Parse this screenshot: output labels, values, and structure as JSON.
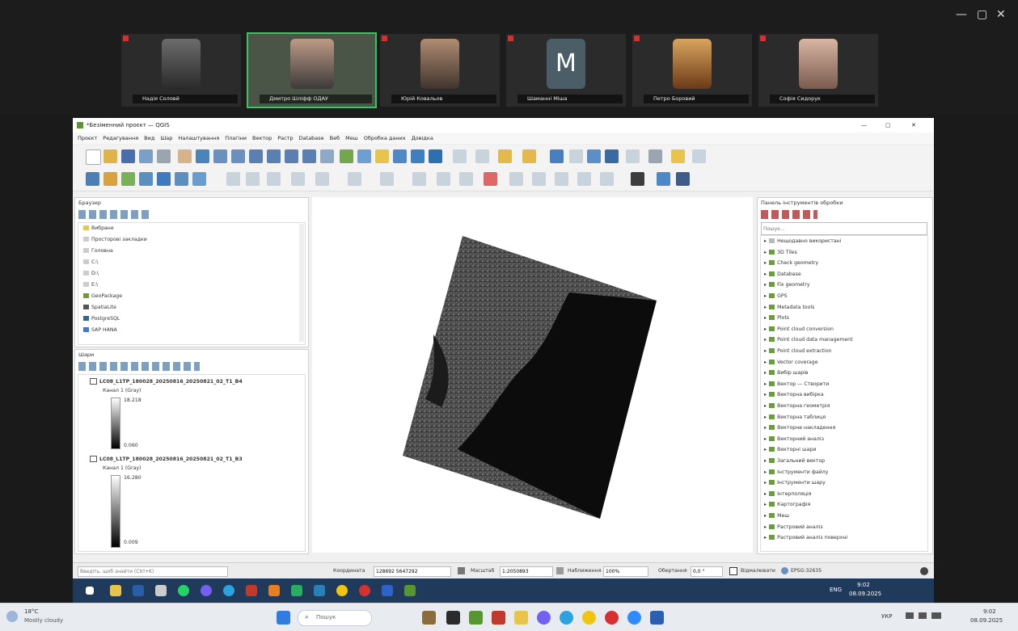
{
  "meeting": {
    "participants": [
      {
        "name": "Надія Соловй",
        "active": false
      },
      {
        "name": "Дмитро Шліфф ОДАУ",
        "active": true
      },
      {
        "name": "Юрій Ковальов",
        "active": false
      },
      {
        "name": "Шаманні Міша",
        "active": false,
        "initial": "M"
      },
      {
        "name": "Петро Боровий",
        "active": false
      },
      {
        "name": "Софія Сидорук",
        "active": false
      }
    ],
    "window_controls": [
      "—",
      "▢",
      "✕"
    ]
  },
  "qgis": {
    "title": "*Безіменний проєкт — QGIS",
    "window_controls": [
      "—",
      "▢",
      "✕"
    ],
    "menu": [
      "Проєкт",
      "Редагування",
      "Вид",
      "Шар",
      "Налаштування",
      "Плагіни",
      "Вектор",
      "Растр",
      "Database",
      "Веб",
      "Меш",
      "Обробка даних",
      "Довідка"
    ],
    "browser": {
      "title": "Браузер",
      "items": [
        "Вибране",
        "Просторові закладки",
        "Головна",
        "C:\\",
        "D:\\",
        "E:\\",
        "GeoPackage",
        "SpatiaLite",
        "PostgreSQL",
        "SAP HANA"
      ]
    },
    "layers": {
      "title": "Шари",
      "items": [
        {
          "name": "LC08_L1TP_180028_20250816_20250821_02_T1_B4",
          "band": "Канал 1 (Gray)",
          "max": "18.218",
          "min": "0.060"
        },
        {
          "name": "LC08_L1TP_180028_20250816_20250821_02_T1_B3",
          "band": "Канал 1 (Gray)",
          "max": "16.280",
          "min": "0.009"
        }
      ]
    },
    "processing": {
      "title": "Панель інструментів обробки",
      "search_placeholder": "Пошук...",
      "items": [
        "Нещодавно використані",
        "3D Tiles",
        "Check geometry",
        "Database",
        "Fix geometry",
        "GPS",
        "Metadata tools",
        "Plots",
        "Point cloud conversion",
        "Point cloud data management",
        "Point cloud extraction",
        "Vector coverage",
        "Вибір шарів",
        "Вектор — Створити",
        "Векторна вибірка",
        "Векторна геометрія",
        "Векторна таблиця",
        "Векторне накладення",
        "Векторний аналіз",
        "Векторні шари",
        "Загальний вектор",
        "Інструменти файлу",
        "Інструменти шару",
        "Інтерполяція",
        "Картографія",
        "Меш",
        "Растровий аналіз",
        "Растровий аналіз поверхні"
      ]
    },
    "status": {
      "search_placeholder": "Введіть, щоб знайти (Ctrl+K)",
      "coord_label": "Координата",
      "coord_value": "128692 5647292",
      "scale_label": "Масштаб",
      "scale_value": "1:2050893",
      "magnifier_label": "Наближення",
      "magnifier_value": "100%",
      "rotation_label": "Обертання",
      "rotation_value": "0,0 °",
      "render_label": "Відмалювати",
      "crs": "EPSG:32635"
    }
  },
  "remote_taskbar": {
    "time": "9:02",
    "date": "08.09.2025",
    "lang": "ENG"
  },
  "local_taskbar": {
    "weather_temp": "18°C",
    "weather_desc": "Mostly cloudy",
    "search_placeholder": "Пошук",
    "lang": "УКР",
    "time": "9:02",
    "date": "08.09.2025"
  }
}
